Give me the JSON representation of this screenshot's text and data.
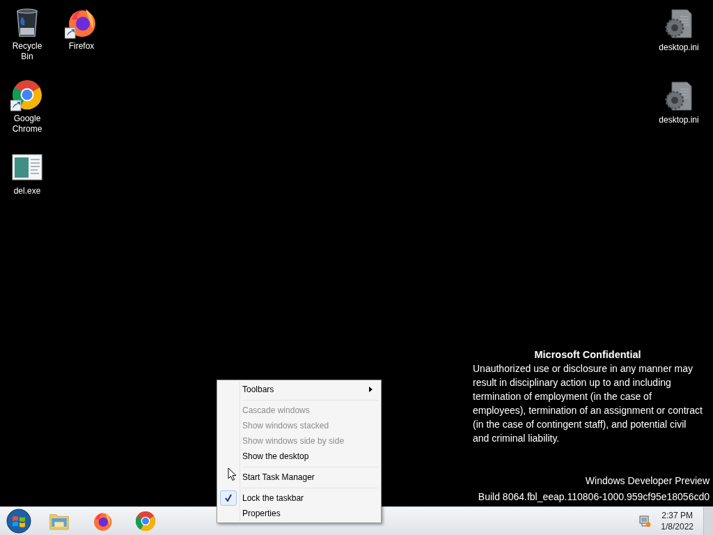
{
  "desktop": {
    "left_icons": [
      {
        "label": "Recycle Bin",
        "kind": "recycle",
        "shortcut": false
      },
      {
        "label": "Google Chrome",
        "kind": "chrome",
        "shortcut": true
      },
      {
        "label": "del.exe",
        "kind": "exe",
        "shortcut": false
      },
      {
        "label": "Firefox",
        "kind": "firefox",
        "shortcut": true
      }
    ],
    "right_icons": [
      {
        "label": "desktop.ini",
        "kind": "ini",
        "shortcut": false
      },
      {
        "label": "desktop.ini",
        "kind": "ini",
        "shortcut": false
      }
    ]
  },
  "watermark": {
    "heading": "Microsoft Confidential",
    "body": "Unauthorized use or disclosure in any manner may result in disciplinary action up to and including termination of employment (in the case of employees), termination of an assignment or contract (in the case of contingent staff), and potential civil and criminal liability.",
    "edition": "Windows Developer Preview",
    "build": "Build 8064.fbl_eeap.110806-1000.959cf95e18056cd0"
  },
  "context_menu": {
    "items": [
      {
        "kind": "item",
        "label": "Toolbars",
        "disabled": false,
        "checked": false,
        "submenu": true
      },
      {
        "kind": "separator"
      },
      {
        "kind": "item",
        "label": "Cascade windows",
        "disabled": true,
        "checked": false,
        "submenu": false
      },
      {
        "kind": "item",
        "label": "Show windows stacked",
        "disabled": true,
        "checked": false,
        "submenu": false
      },
      {
        "kind": "item",
        "label": "Show windows side by side",
        "disabled": true,
        "checked": false,
        "submenu": false
      },
      {
        "kind": "item",
        "label": "Show the desktop",
        "disabled": false,
        "checked": false,
        "submenu": false
      },
      {
        "kind": "separator"
      },
      {
        "kind": "item",
        "label": "Start Task Manager",
        "disabled": false,
        "checked": false,
        "submenu": false
      },
      {
        "kind": "separator"
      },
      {
        "kind": "item",
        "label": "Lock the taskbar",
        "disabled": false,
        "checked": true,
        "submenu": false
      },
      {
        "kind": "item",
        "label": "Properties",
        "disabled": false,
        "checked": false,
        "submenu": false
      }
    ]
  },
  "taskbar": {
    "pinned": [
      {
        "kind": "explorer"
      },
      {
        "kind": "firefox"
      },
      {
        "kind": "chrome"
      }
    ],
    "clock": {
      "time": "2:37 PM",
      "date": "1/8/2022"
    }
  }
}
